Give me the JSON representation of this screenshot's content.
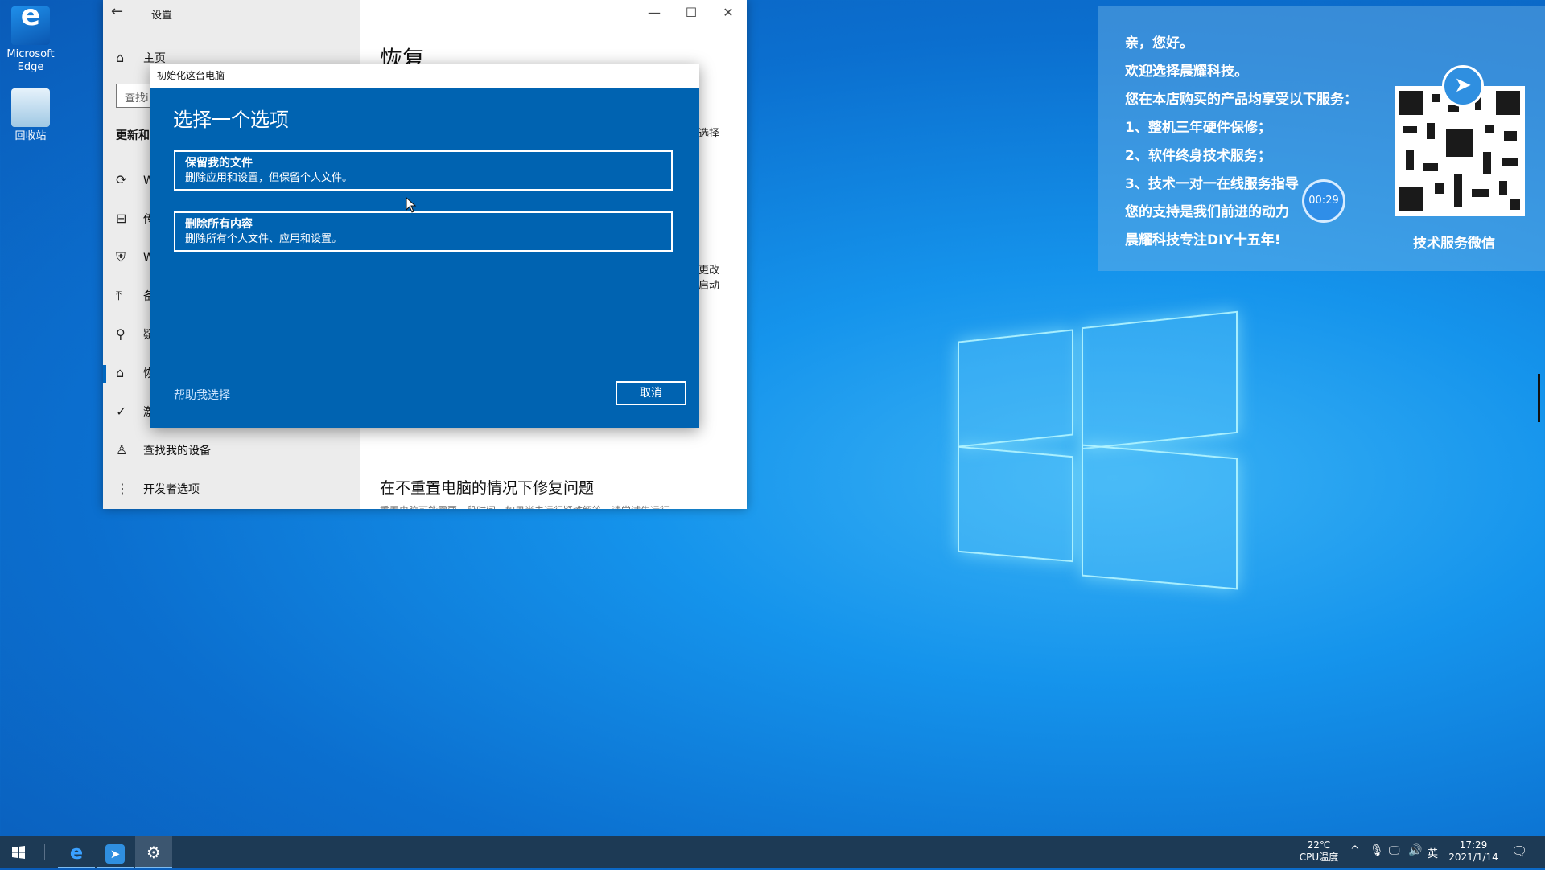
{
  "desktop": {
    "icons": [
      {
        "label_line1": "Microsoft",
        "label_line2": "Edge"
      },
      {
        "label_line1": "回收站",
        "label_line2": ""
      }
    ]
  },
  "settings": {
    "title": "设置",
    "page_title": "恢复",
    "search_placeholder": "查找设置",
    "search_visible": "查找i",
    "section": "更新和安全",
    "nav": [
      {
        "icon": "home-icon",
        "label": "主页"
      },
      {
        "icon": "sync-icon",
        "label": "W"
      },
      {
        "icon": "delivery-icon",
        "label": "传"
      },
      {
        "icon": "shield-icon",
        "label": "W"
      },
      {
        "icon": "backup-icon",
        "label": "备"
      },
      {
        "icon": "wrench-icon",
        "label": "疑"
      },
      {
        "icon": "recovery-icon",
        "label": "恢"
      },
      {
        "icon": "activation-icon",
        "label": "激"
      },
      {
        "icon": "find-device-icon",
        "label": "查找我的设备"
      },
      {
        "icon": "developer-icon",
        "label": "开发者选项"
      }
    ],
    "fragments": {
      "choose": "选择",
      "change": "更改",
      "startup": "启动"
    },
    "repair_heading": "在不重置电脑的情况下修复问题",
    "repair_text": "重置电脑可能需要一段时间。如果尚未运行疑难解答，请尝试先运行"
  },
  "dialog": {
    "title": "初始化这台电脑",
    "heading": "选择一个选项",
    "options": [
      {
        "title": "保留我的文件",
        "desc": "删除应用和设置，但保留个人文件。"
      },
      {
        "title": "删除所有内容",
        "desc": "删除所有个人文件、应用和设置。"
      }
    ],
    "help_link": "帮助我选择",
    "cancel": "取消"
  },
  "panel": {
    "lines": [
      "亲，您好。",
      "欢迎选择晨耀科技。",
      "您在本店购买的产品均享受以下服务：",
      "1、整机三年硬件保修；",
      "2、软件终身技术服务；",
      "3、技术一对一在线服务指导",
      "您的支持是我们前进的动力",
      "晨耀科技专注DIY十五年!"
    ],
    "qr_caption": "技术服务微信",
    "timer": "00:29"
  },
  "taskbar": {
    "temp": "22℃",
    "temp_label": "CPU温度",
    "ime": "英",
    "time": "17:29",
    "date": "2021/1/14"
  },
  "colors": {
    "dialog_bg": "#0063b1",
    "accent": "#0067c0",
    "taskbar": "#1d3a55"
  }
}
